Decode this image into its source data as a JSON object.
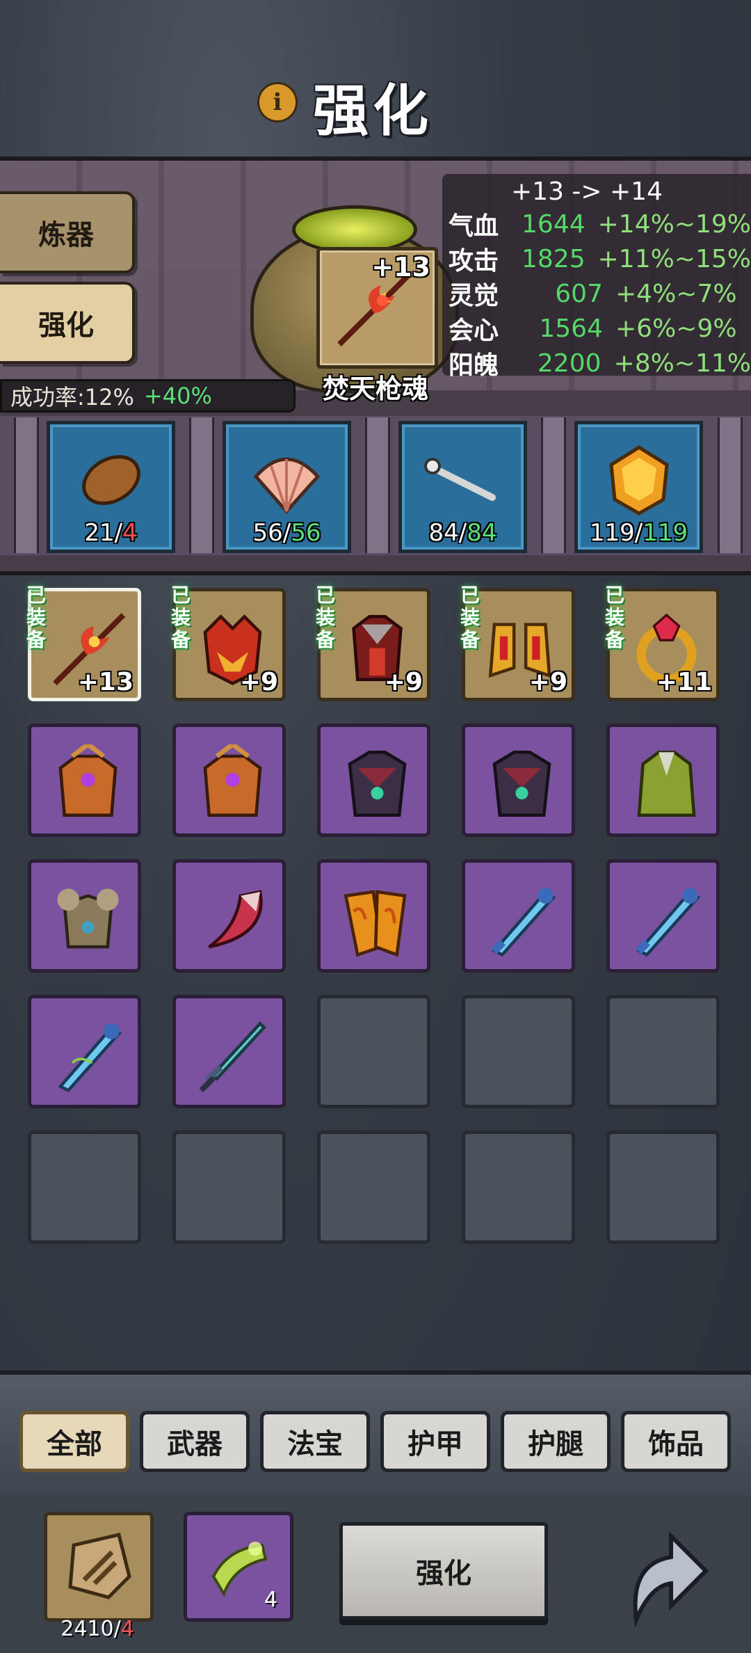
{
  "header": {
    "title": "强化",
    "info_icon": "i"
  },
  "side_tabs": {
    "refine": "炼器",
    "enhance": "强化"
  },
  "success": {
    "label": "成功率:12%",
    "bonus": "+40%"
  },
  "selected_item": {
    "level": "+13",
    "name": "焚天枪魂"
  },
  "stats": {
    "header": "+13 -> +14",
    "rows": [
      {
        "name": "气血",
        "value": "1644",
        "range": "+14%~19%"
      },
      {
        "name": "攻击",
        "value": "1825",
        "range": "+11%~15%"
      },
      {
        "name": "灵觉",
        "value": "607",
        "range": "+4%~7%"
      },
      {
        "name": "会心",
        "value": "1564",
        "range": "+6%~9%"
      },
      {
        "name": "阳魄",
        "value": "2200",
        "range": "+8%~11%"
      }
    ]
  },
  "materials": [
    {
      "icon": "bean-icon",
      "have": "21/",
      "need": "4",
      "enough": false
    },
    {
      "icon": "shell-icon",
      "have": "56/",
      "need": "56",
      "enough": true
    },
    {
      "icon": "bone-staff-icon",
      "have": "84/",
      "need": "84",
      "enough": true
    },
    {
      "icon": "amber-gem-icon",
      "have": "119/",
      "need": "119",
      "enough": true
    }
  ],
  "equipped_label": "已\n装\n备",
  "inventory": {
    "row1": [
      {
        "icon": "flame-spear-icon",
        "level": "+13"
      },
      {
        "icon": "demon-helmet-icon",
        "level": "+9"
      },
      {
        "icon": "red-armor-icon",
        "level": "+9"
      },
      {
        "icon": "golden-boots-icon",
        "level": "+9"
      },
      {
        "icon": "ruby-ring-icon",
        "level": "+11"
      }
    ]
  },
  "categories": [
    "全部",
    "武器",
    "法宝",
    "护甲",
    "护腿",
    "饰品"
  ],
  "bottom": {
    "stone_have": "2410/",
    "stone_need": "4",
    "scroll_count": "4",
    "enhance_button": "强化"
  },
  "colors": {
    "accent_green": "#5ce07a",
    "warning_red": "#ff4f4f",
    "gold_slot": "#a88e5c",
    "purple_slot": "#7b52a0"
  }
}
